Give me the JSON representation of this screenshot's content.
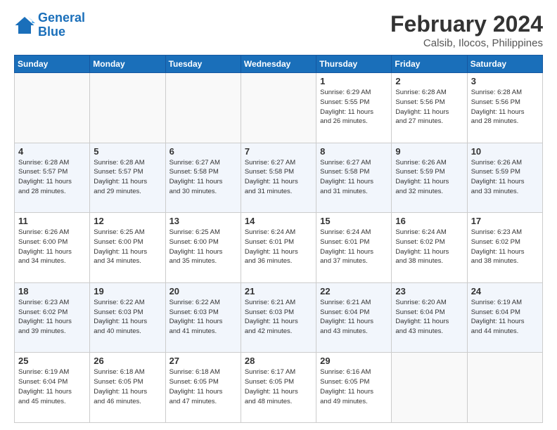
{
  "logo": {
    "line1": "General",
    "line2": "Blue"
  },
  "title": "February 2024",
  "subtitle": "Calsib, Ilocos, Philippines",
  "days_of_week": [
    "Sunday",
    "Monday",
    "Tuesday",
    "Wednesday",
    "Thursday",
    "Friday",
    "Saturday"
  ],
  "weeks": [
    [
      {
        "day": "",
        "info": ""
      },
      {
        "day": "",
        "info": ""
      },
      {
        "day": "",
        "info": ""
      },
      {
        "day": "",
        "info": ""
      },
      {
        "day": "1",
        "info": "Sunrise: 6:29 AM\nSunset: 5:55 PM\nDaylight: 11 hours\nand 26 minutes."
      },
      {
        "day": "2",
        "info": "Sunrise: 6:28 AM\nSunset: 5:56 PM\nDaylight: 11 hours\nand 27 minutes."
      },
      {
        "day": "3",
        "info": "Sunrise: 6:28 AM\nSunset: 5:56 PM\nDaylight: 11 hours\nand 28 minutes."
      }
    ],
    [
      {
        "day": "4",
        "info": "Sunrise: 6:28 AM\nSunset: 5:57 PM\nDaylight: 11 hours\nand 28 minutes."
      },
      {
        "day": "5",
        "info": "Sunrise: 6:28 AM\nSunset: 5:57 PM\nDaylight: 11 hours\nand 29 minutes."
      },
      {
        "day": "6",
        "info": "Sunrise: 6:27 AM\nSunset: 5:58 PM\nDaylight: 11 hours\nand 30 minutes."
      },
      {
        "day": "7",
        "info": "Sunrise: 6:27 AM\nSunset: 5:58 PM\nDaylight: 11 hours\nand 31 minutes."
      },
      {
        "day": "8",
        "info": "Sunrise: 6:27 AM\nSunset: 5:58 PM\nDaylight: 11 hours\nand 31 minutes."
      },
      {
        "day": "9",
        "info": "Sunrise: 6:26 AM\nSunset: 5:59 PM\nDaylight: 11 hours\nand 32 minutes."
      },
      {
        "day": "10",
        "info": "Sunrise: 6:26 AM\nSunset: 5:59 PM\nDaylight: 11 hours\nand 33 minutes."
      }
    ],
    [
      {
        "day": "11",
        "info": "Sunrise: 6:26 AM\nSunset: 6:00 PM\nDaylight: 11 hours\nand 34 minutes."
      },
      {
        "day": "12",
        "info": "Sunrise: 6:25 AM\nSunset: 6:00 PM\nDaylight: 11 hours\nand 34 minutes."
      },
      {
        "day": "13",
        "info": "Sunrise: 6:25 AM\nSunset: 6:00 PM\nDaylight: 11 hours\nand 35 minutes."
      },
      {
        "day": "14",
        "info": "Sunrise: 6:24 AM\nSunset: 6:01 PM\nDaylight: 11 hours\nand 36 minutes."
      },
      {
        "day": "15",
        "info": "Sunrise: 6:24 AM\nSunset: 6:01 PM\nDaylight: 11 hours\nand 37 minutes."
      },
      {
        "day": "16",
        "info": "Sunrise: 6:24 AM\nSunset: 6:02 PM\nDaylight: 11 hours\nand 38 minutes."
      },
      {
        "day": "17",
        "info": "Sunrise: 6:23 AM\nSunset: 6:02 PM\nDaylight: 11 hours\nand 38 minutes."
      }
    ],
    [
      {
        "day": "18",
        "info": "Sunrise: 6:23 AM\nSunset: 6:02 PM\nDaylight: 11 hours\nand 39 minutes."
      },
      {
        "day": "19",
        "info": "Sunrise: 6:22 AM\nSunset: 6:03 PM\nDaylight: 11 hours\nand 40 minutes."
      },
      {
        "day": "20",
        "info": "Sunrise: 6:22 AM\nSunset: 6:03 PM\nDaylight: 11 hours\nand 41 minutes."
      },
      {
        "day": "21",
        "info": "Sunrise: 6:21 AM\nSunset: 6:03 PM\nDaylight: 11 hours\nand 42 minutes."
      },
      {
        "day": "22",
        "info": "Sunrise: 6:21 AM\nSunset: 6:04 PM\nDaylight: 11 hours\nand 43 minutes."
      },
      {
        "day": "23",
        "info": "Sunrise: 6:20 AM\nSunset: 6:04 PM\nDaylight: 11 hours\nand 43 minutes."
      },
      {
        "day": "24",
        "info": "Sunrise: 6:19 AM\nSunset: 6:04 PM\nDaylight: 11 hours\nand 44 minutes."
      }
    ],
    [
      {
        "day": "25",
        "info": "Sunrise: 6:19 AM\nSunset: 6:04 PM\nDaylight: 11 hours\nand 45 minutes."
      },
      {
        "day": "26",
        "info": "Sunrise: 6:18 AM\nSunset: 6:05 PM\nDaylight: 11 hours\nand 46 minutes."
      },
      {
        "day": "27",
        "info": "Sunrise: 6:18 AM\nSunset: 6:05 PM\nDaylight: 11 hours\nand 47 minutes."
      },
      {
        "day": "28",
        "info": "Sunrise: 6:17 AM\nSunset: 6:05 PM\nDaylight: 11 hours\nand 48 minutes."
      },
      {
        "day": "29",
        "info": "Sunrise: 6:16 AM\nSunset: 6:05 PM\nDaylight: 11 hours\nand 49 minutes."
      },
      {
        "day": "",
        "info": ""
      },
      {
        "day": "",
        "info": ""
      }
    ]
  ]
}
